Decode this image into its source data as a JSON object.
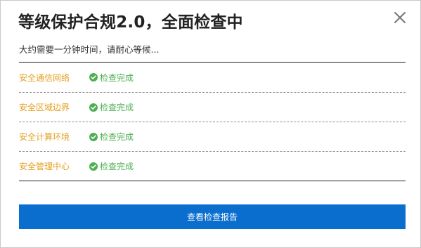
{
  "dialog": {
    "title": "等级保护合规2.0，全面检查中",
    "subtitle": "大约需要一分钟时间，请耐心等候...",
    "close_icon": "close-icon"
  },
  "checks": [
    {
      "label": "安全通信网络",
      "status": "检查完成",
      "status_icon": "check-circle-icon"
    },
    {
      "label": "安全区域边界",
      "status": "检查完成",
      "status_icon": "check-circle-icon"
    },
    {
      "label": "安全计算环境",
      "status": "检查完成",
      "status_icon": "check-circle-icon"
    },
    {
      "label": "安全管理中心",
      "status": "检查完成",
      "status_icon": "check-circle-icon"
    }
  ],
  "report_button": {
    "label": "查看检查报告"
  },
  "colors": {
    "label": "#e3a020",
    "status_ok": "#4caf50",
    "primary": "#0a6ecf"
  }
}
